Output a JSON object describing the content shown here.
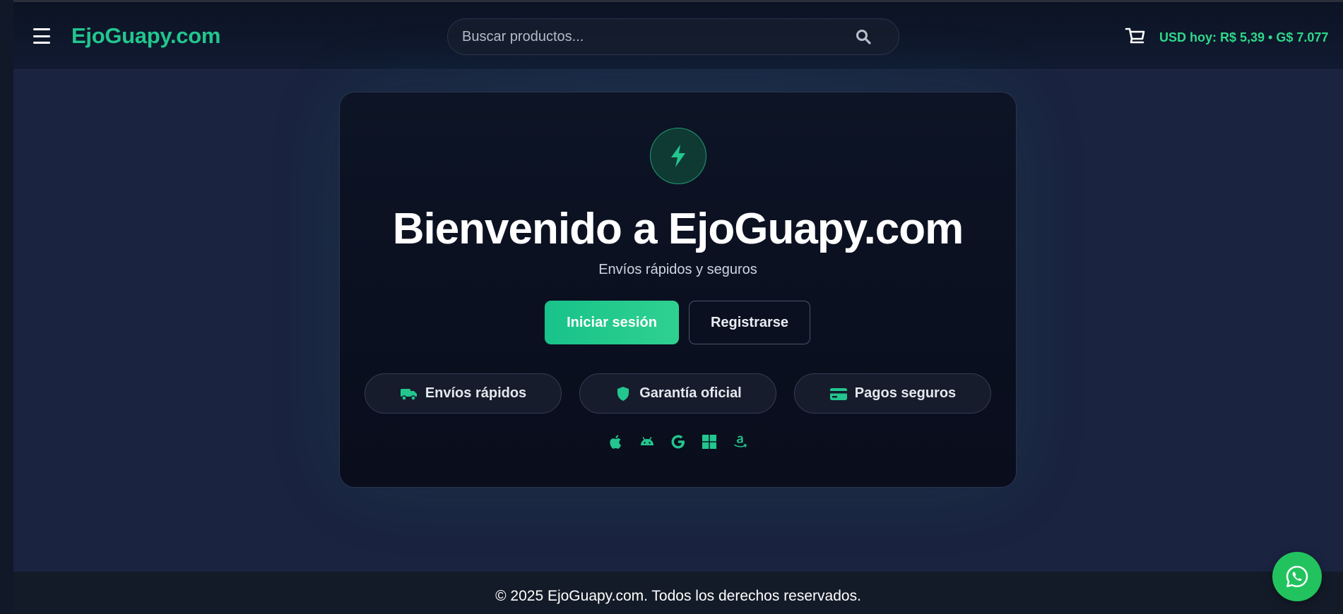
{
  "header": {
    "brand": "EjoGuapy.com",
    "search_placeholder": "Buscar productos...",
    "exchange_rate": "USD hoy: R$ 5,39 • G$ 7.077"
  },
  "hero": {
    "title": "Bienvenido a EjoGuapy.com",
    "subtitle": "Envíos rápidos y seguros",
    "login_label": "Iniciar sesión",
    "register_label": "Registrarse"
  },
  "features": [
    {
      "label": "Envíos rápidos",
      "icon": "truck-icon"
    },
    {
      "label": "Garantía oficial",
      "icon": "shield-icon"
    },
    {
      "label": "Pagos seguros",
      "icon": "credit-card-icon"
    }
  ],
  "platforms": [
    "apple-icon",
    "android-icon",
    "google-icon",
    "windows-icon",
    "amazon-icon"
  ],
  "footer": {
    "copyright": "© 2025 EjoGuapy.com. Todos los derechos reservados."
  },
  "colors": {
    "accent": "#22c68e",
    "rate_text": "#2ed889",
    "whatsapp": "#22c35e",
    "background": "#1a2340"
  }
}
